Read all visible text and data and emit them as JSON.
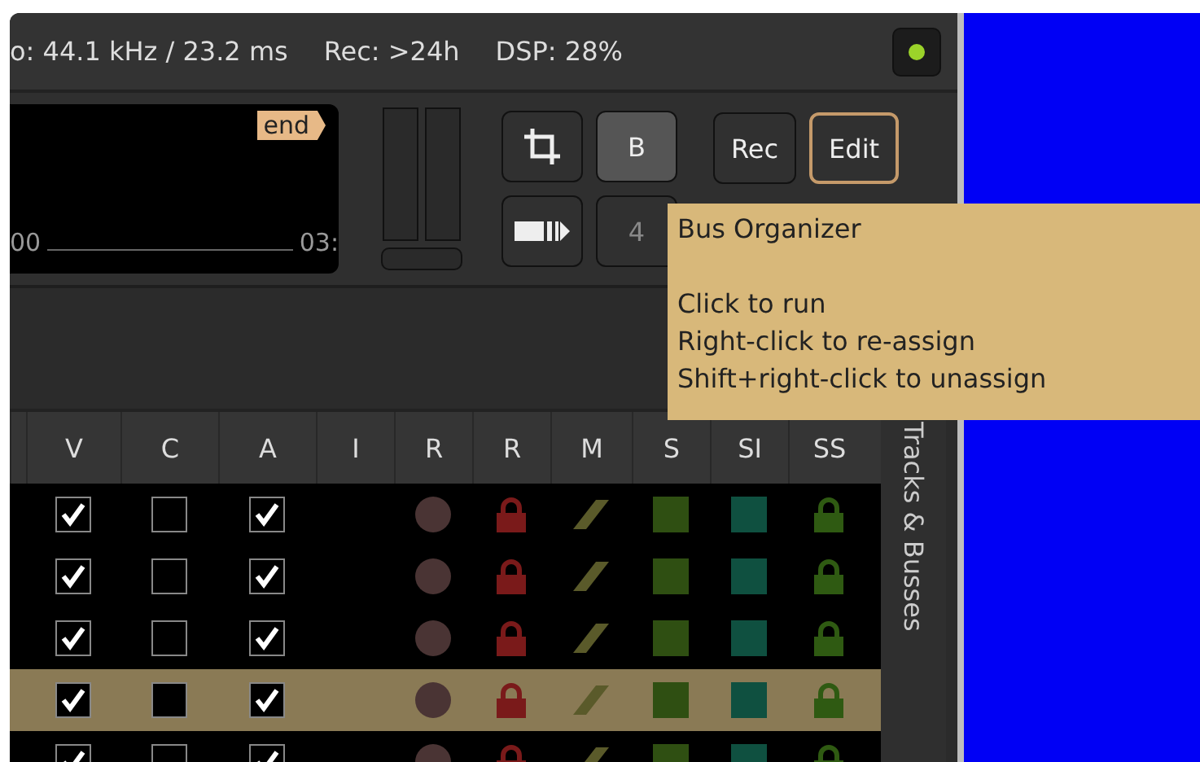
{
  "status_bar": {
    "items": [
      "o: 44.1 kHz / 23.2 ms",
      "Rec: >24h",
      "DSP: 28%"
    ],
    "led_on": true
  },
  "clock": {
    "marker": "end",
    "ruler_labels": [
      "00",
      "03:"
    ]
  },
  "tool_buttons": [
    {
      "kind": "crop"
    },
    {
      "kind": "text",
      "label": "B",
      "disabled": false
    },
    {
      "kind": "range"
    },
    {
      "kind": "text",
      "label": "4",
      "disabled": true
    }
  ],
  "mode_buttons": [
    {
      "label": "Rec",
      "selected": false
    },
    {
      "label": "Edit",
      "selected": true
    }
  ],
  "table": {
    "columns": [
      "V",
      "C",
      "A",
      "I",
      "R",
      "R",
      "M",
      "S",
      "SI",
      "SS"
    ],
    "rows": [
      {
        "v": true,
        "c": false,
        "a": true,
        "selected": false
      },
      {
        "v": true,
        "c": false,
        "a": true,
        "selected": false
      },
      {
        "v": true,
        "c": false,
        "a": true,
        "selected": false
      },
      {
        "v": true,
        "c": false,
        "a": true,
        "selected": true
      },
      {
        "v": true,
        "c": false,
        "a": true,
        "selected": false
      }
    ]
  },
  "side_tab": {
    "label": "Tracks & Busses"
  },
  "tooltip": {
    "title": "Bus Organizer",
    "lines": [
      "Click to run",
      "Right-click to re-assign",
      "Shift+right-click to unassign"
    ]
  }
}
